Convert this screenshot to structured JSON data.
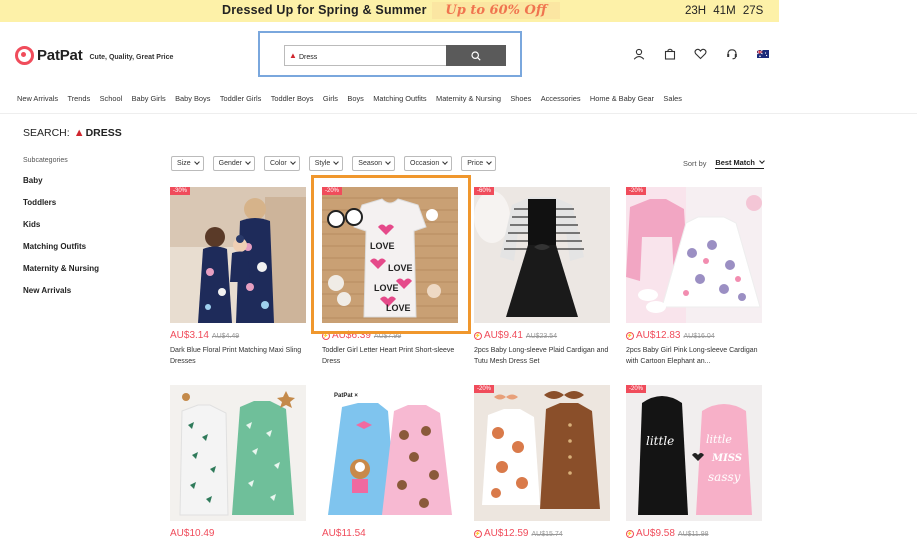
{
  "promo": {
    "title": "Dressed Up for Spring & Summer",
    "discount": "Up to 60% Off",
    "countdown": "23H 41M 27S"
  },
  "header": {
    "logo": "PatPat",
    "tagline": "Cute, Quality, Great Price"
  },
  "search": {
    "value": "Dress",
    "icon": "search-icon"
  },
  "header_icons": [
    "user-icon",
    "bag-icon",
    "heart-icon",
    "support-icon",
    "flag-icon"
  ],
  "nav": [
    "New Arrivals",
    "Trends",
    "School",
    "Baby Girls",
    "Baby Boys",
    "Toddler Girls",
    "Toddler Boys",
    "Girls",
    "Boys",
    "Matching Outfits",
    "Maternity & Nursing",
    "Shoes",
    "Accessories",
    "Home & Baby Gear",
    "Sales"
  ],
  "search_title": {
    "prefix": "SEARCH:",
    "term": "DRESS"
  },
  "sidebar": {
    "heading": "Subcategories",
    "items": [
      "Baby",
      "Toddlers",
      "Kids",
      "Matching Outfits",
      "Maternity & Nursing",
      "New Arrivals"
    ]
  },
  "filters": [
    "Size",
    "Gender",
    "Color",
    "Style",
    "Season",
    "Occasion",
    "Price"
  ],
  "sort": {
    "label": "Sort by",
    "value": "Best Match"
  },
  "products": [
    {
      "badge": "-30%",
      "price": "AU$3.14",
      "old": "AU$4.49",
      "name": "Dark Blue Floral Print Matching Maxi Sling Dresses",
      "flash": false
    },
    {
      "badge": "-20%",
      "price": "AU$6.39",
      "old": "AU$7.99",
      "name": "Toddler Girl Letter Heart Print Short-sleeve Dress",
      "flash": true
    },
    {
      "badge": "-60%",
      "price": "AU$9.41",
      "old": "AU$23.54",
      "name": "2pcs Baby Long-sleeve Plaid Cardigan and Tutu Mesh Dress Set",
      "flash": true
    },
    {
      "badge": "-20%",
      "price": "AU$12.83",
      "old": "AU$16.04",
      "name": "2pcs Baby Girl Pink Long-sleeve Cardigan with Cartoon Elephant an...",
      "flash": true
    },
    {
      "badge": "",
      "price": "AU$10.49",
      "old": "",
      "name": "",
      "flash": false
    },
    {
      "badge": "",
      "price": "AU$11.54",
      "old": "",
      "name": "",
      "flash": false
    },
    {
      "badge": "-20%",
      "price": "AU$12.59",
      "old": "AU$15.74",
      "name": "",
      "flash": true
    },
    {
      "badge": "-20%",
      "price": "AU$9.58",
      "old": "AU$11.98",
      "name": "",
      "flash": true
    }
  ],
  "product4_brand": "PatPat",
  "product4_brand_cross": "×",
  "thumb_text": {
    "love": "LOVE",
    "little": "little",
    "miss": "MISS",
    "sassy": "sassy"
  }
}
